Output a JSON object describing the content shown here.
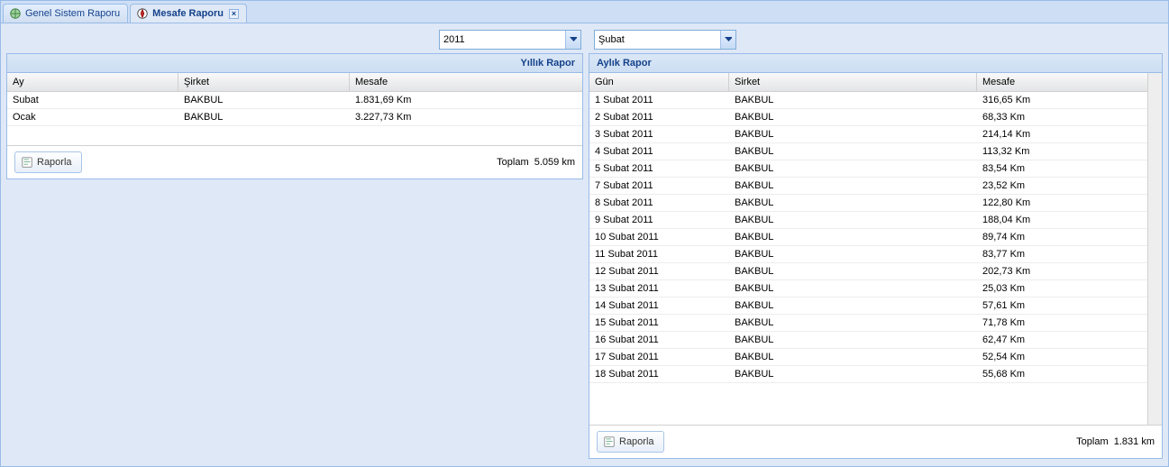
{
  "tabs": {
    "inactive_label": "Genel Sistem Raporu",
    "active_label": "Mesafe Raporu"
  },
  "selectors": {
    "year": "2011",
    "month": "Şubat"
  },
  "yearly": {
    "title": "Yıllık Rapor",
    "headers": {
      "month": "Ay",
      "company": "Şirket",
      "distance": "Mesafe"
    },
    "rows": [
      {
        "month": "Subat",
        "company": "BAKBUL",
        "distance": "1.831,69 Km"
      },
      {
        "month": "Ocak",
        "company": "BAKBUL",
        "distance": "3.227,73 Km"
      }
    ],
    "total_label": "Toplam",
    "total_value": "5.059 km",
    "button": "Raporla"
  },
  "monthly": {
    "title": "Aylık Rapor",
    "headers": {
      "day": "Gün",
      "company": "Sirket",
      "distance": "Mesafe"
    },
    "rows": [
      {
        "day": "1 Subat 2011",
        "company": "BAKBUL",
        "distance": "316,65 Km"
      },
      {
        "day": "2 Subat 2011",
        "company": "BAKBUL",
        "distance": "68,33 Km"
      },
      {
        "day": "3 Subat 2011",
        "company": "BAKBUL",
        "distance": "214,14 Km"
      },
      {
        "day": "4 Subat 2011",
        "company": "BAKBUL",
        "distance": "113,32 Km"
      },
      {
        "day": "5 Subat 2011",
        "company": "BAKBUL",
        "distance": "83,54 Km"
      },
      {
        "day": "7 Subat 2011",
        "company": "BAKBUL",
        "distance": "23,52 Km"
      },
      {
        "day": "8 Subat 2011",
        "company": "BAKBUL",
        "distance": "122,80 Km"
      },
      {
        "day": "9 Subat 2011",
        "company": "BAKBUL",
        "distance": "188,04 Km"
      },
      {
        "day": "10 Subat 2011",
        "company": "BAKBUL",
        "distance": "89,74 Km"
      },
      {
        "day": "11 Subat 2011",
        "company": "BAKBUL",
        "distance": "83,77 Km"
      },
      {
        "day": "12 Subat 2011",
        "company": "BAKBUL",
        "distance": "202,73 Km"
      },
      {
        "day": "13 Subat 2011",
        "company": "BAKBUL",
        "distance": "25,03 Km"
      },
      {
        "day": "14 Subat 2011",
        "company": "BAKBUL",
        "distance": "57,61 Km"
      },
      {
        "day": "15 Subat 2011",
        "company": "BAKBUL",
        "distance": "71,78 Km"
      },
      {
        "day": "16 Subat 2011",
        "company": "BAKBUL",
        "distance": "62,47 Km"
      },
      {
        "day": "17 Subat 2011",
        "company": "BAKBUL",
        "distance": "52,54 Km"
      },
      {
        "day": "18 Subat 2011",
        "company": "BAKBUL",
        "distance": "55,68 Km"
      }
    ],
    "total_label": "Toplam",
    "total_value": "1.831 km",
    "button": "Raporla"
  }
}
